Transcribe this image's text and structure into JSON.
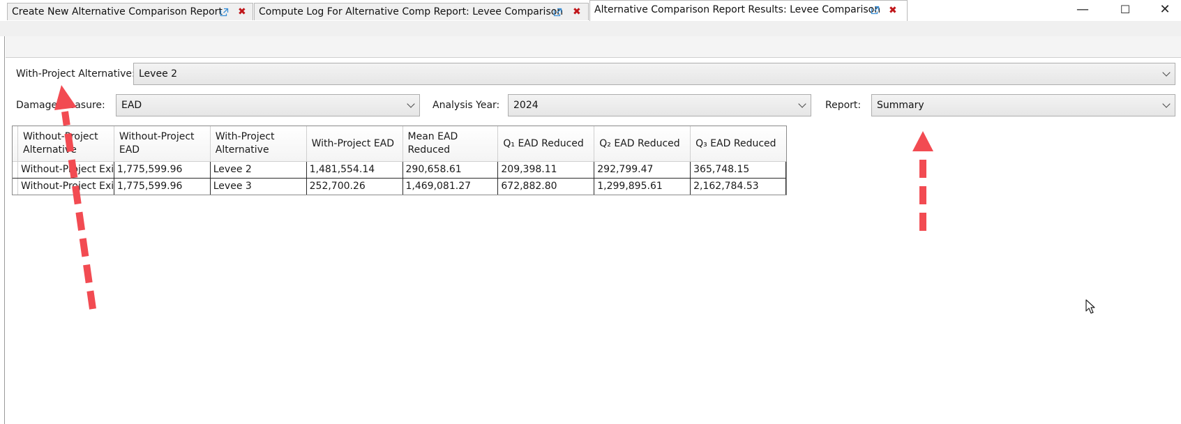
{
  "window": {
    "minimize_glyph": "—",
    "maximize_glyph": "☐",
    "close_glyph": "✕"
  },
  "tabs": [
    {
      "label": "Create New Alternative Comparison Report",
      "active": false
    },
    {
      "label": "Compute Log For Alternative Comp Report: Levee Comparison",
      "active": false
    },
    {
      "label": "Alternative Comparison Report Results: Levee Comparison",
      "active": true
    }
  ],
  "tab_close_glyph": "✖",
  "with_project": {
    "label": "With-Project Alternative:",
    "value": "Levee 2"
  },
  "damage_measure": {
    "label": "Damage Measure:",
    "value": "EAD"
  },
  "analysis_year": {
    "label": "Analysis Year:",
    "value": "2024"
  },
  "report": {
    "label": "Report:",
    "value": "Summary"
  },
  "table": {
    "columns": [
      "Without-Project Alternative",
      "Without-Project EAD",
      "With-Project Alternative",
      "With-Project EAD",
      "Mean EAD Reduced",
      "Q₁ EAD Reduced",
      "Q₂ EAD Reduced",
      "Q₃ EAD Reduced"
    ],
    "rows": [
      [
        "Without-Project Exi",
        "1,775,599.96",
        "Levee 2",
        "1,481,554.14",
        "290,658.61",
        "209,398.11",
        "292,799.47",
        "365,748.15"
      ],
      [
        "Without-Project Exi",
        "1,775,599.96",
        "Levee 3",
        "252,700.26",
        "1,469,081.27",
        "672,882.80",
        "1,299,895.61",
        "2,162,784.53"
      ]
    ]
  },
  "colors": {
    "annotation_arrow": "#f24b52",
    "tab_close": "#c0161a"
  }
}
